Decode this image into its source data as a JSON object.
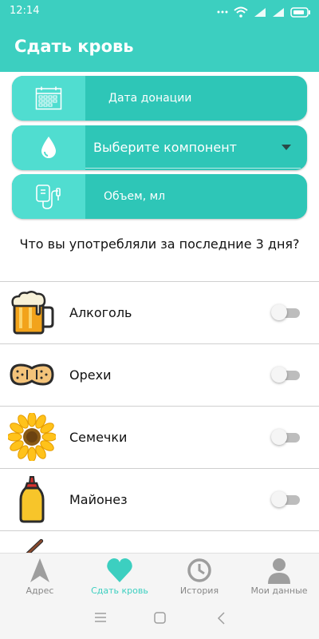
{
  "status_bar": {
    "time": "12:14"
  },
  "app_bar": {
    "title": "Сдать кровь"
  },
  "form": {
    "date_label": "Дата донации",
    "component_label": "Выберите компонент",
    "volume_label": "Объем, мл"
  },
  "question": "Что вы употребляли за последние 3 дня?",
  "foods": [
    {
      "label": "Алкоголь",
      "icon": "beer-icon",
      "on": false
    },
    {
      "label": "Орехи",
      "icon": "peanut-icon",
      "on": false
    },
    {
      "label": "Семечки",
      "icon": "sunflower-icon",
      "on": false
    },
    {
      "label": "Майонез",
      "icon": "mayonnaise-icon",
      "on": false
    }
  ],
  "bottom_nav": {
    "items": [
      {
        "label": "Адрес",
        "icon": "location-arrow-icon",
        "active": false
      },
      {
        "label": "Сдать кровь",
        "icon": "heart-icon",
        "active": true
      },
      {
        "label": "История",
        "icon": "clock-icon",
        "active": false
      },
      {
        "label": "Мои данные",
        "icon": "person-icon",
        "active": false
      }
    ]
  },
  "colors": {
    "primary": "#3ccfc0",
    "field_dark": "#2ec6b7",
    "field_icon_bg": "#50ddd0",
    "nav_inactive": "#888888"
  }
}
